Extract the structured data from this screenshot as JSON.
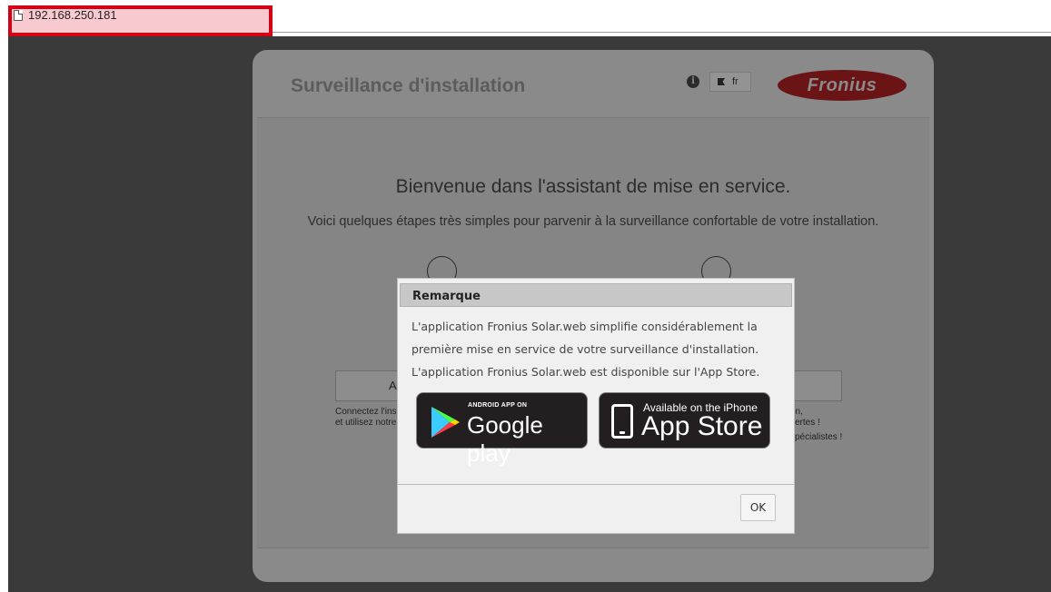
{
  "browser": {
    "url": "192.168.250.181"
  },
  "app": {
    "title": "Surveillance d'installation",
    "info_label": "i",
    "lang_label": "fr",
    "logo_text": "Fronius",
    "welcome": "Bienvenue dans l'assistant de mise en service.",
    "intro": "Voici quelques étapes très simples pour parvenir à la surveillance confortable de votre installation.",
    "steps": [
      {
        "button_label": "A",
        "desc_line1": "Connectez l'ins",
        "desc_line2": "et utilisez notre"
      },
      {
        "button_label": "",
        "desc_line1": "on,",
        "desc_line2": "vertes !",
        "desc_line3": "spécialistes !"
      }
    ]
  },
  "modal": {
    "title": "Remarque",
    "text_line1": "L'application Fronius Solar.web simplifie considérablement la",
    "text_line2": "première mise en service de votre surveillance d'installation.",
    "text_line3": "L'application Fronius Solar.web est disponible sur l'App Store.",
    "google_play": {
      "small": "ANDROID APP ON",
      "big": "Google play"
    },
    "app_store": {
      "small": "Available on the iPhone",
      "big": "App Store"
    },
    "ok_label": "OK"
  },
  "colors": {
    "highlight_border": "#d40015",
    "highlight_fill": "#f8c9cf",
    "backdrop": "#3a3a3a",
    "logo": "#6a1416"
  }
}
